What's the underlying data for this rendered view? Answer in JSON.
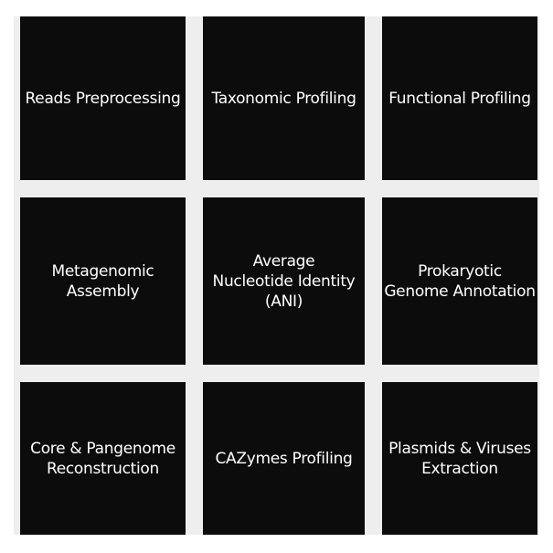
{
  "tiles": [
    {
      "label": "Reads Preprocessing"
    },
    {
      "label": "Taxonomic Profiling"
    },
    {
      "label": "Functional Profiling"
    },
    {
      "label": "Metagenomic\nAssembly"
    },
    {
      "label": "Average\nNucleotide Identity\n(ANI)"
    },
    {
      "label": "Prokaryotic\nGenome Annotation"
    },
    {
      "label": "Core & Pangenome\nReconstruction"
    },
    {
      "label": "CAZymes Profiling"
    },
    {
      "label": "Plasmids & Viruses\nExtraction"
    }
  ],
  "colors": {
    "tile_background": "#0c0c0c",
    "tile_text": "#ffffff",
    "gap_background": "#eeeeee"
  }
}
